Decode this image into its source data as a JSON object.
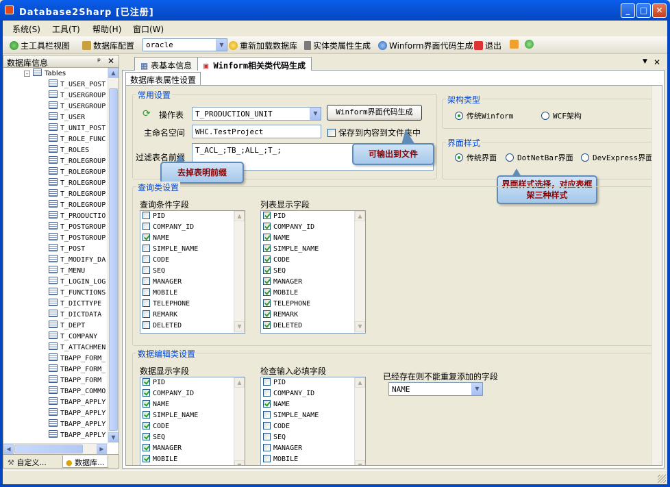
{
  "window": {
    "title": "Database2Sharp [已注册]"
  },
  "menu": [
    "系统(S)",
    "工具(T)",
    "帮助(H)",
    "窗口(W)"
  ],
  "toolbar": {
    "main_view": "主工具栏视图",
    "db_config": "数据库配置",
    "db_type": "oracle",
    "reload_db": "重新加载数据库",
    "entity_gen": "实体类属性生成",
    "winform_gen": "Winform界面代码生成",
    "exit": "退出"
  },
  "left_panel": {
    "title": "数据库信息",
    "root": "Tables",
    "tables": [
      "T_USER_POST",
      "T_USERGROUP",
      "T_USERGROUP",
      "T_USER",
      "T_UNIT_POST",
      "T_ROLE_FUNC",
      "T_ROLES",
      "T_ROLEGROUP",
      "T_ROLEGROUP",
      "T_ROLEGROUP",
      "T_ROLEGROUP",
      "T_ROLEGROUP",
      "T_PRODUCTIO",
      "T_POSTGROUP",
      "T_POSTGROUP",
      "T_POST",
      "T_MODIFY_DA",
      "T_MENU",
      "T_LOGIN_LOG",
      "T_FUNCTIONS",
      "T_DICTTYPE",
      "T_DICTDATA",
      "T_DEPT",
      "T_COMPANY",
      "T_ATTACHMEN",
      "TBAPP_FORM_",
      "TBAPP_FORM_",
      "TBAPP_FORM",
      "TBAPP_COMMO",
      "TBAPP_APPLY",
      "TBAPP_APPLY",
      "TBAPP_APPLY",
      "TBAPP_APPLY"
    ],
    "tab_custom": "自定义...",
    "tab_db": "数据库..."
  },
  "doc_tabs": {
    "tab1": "表基本信息",
    "tab2": "Winform相关类代码生成"
  },
  "sub_tab": "数据库表属性设置",
  "common": {
    "title": "常用设置",
    "table_label": "操作表",
    "table_value": "T_PRODUCTION_UNIT",
    "gen_button": "Winform界面代码生成",
    "ns_label": "主命名空间",
    "ns_value": "WHC.TestProject",
    "save_label": "保存到内容到文件夹中",
    "prefix_label": "过滤表名前缀",
    "prefix_value": "T_ACL_;TB_;ALL_;T_;"
  },
  "arch": {
    "title": "架构类型",
    "opt1": "传统Winform",
    "opt2": "WCF架构"
  },
  "ui_style": {
    "title": "界面样式",
    "opt1": "传统界面",
    "opt2": "DotNetBar界面",
    "opt3": "DevExpress界面"
  },
  "callouts": {
    "prefix": "去掉表明前缀",
    "output": "可输出到文件",
    "style": "界面样式选择，对应表框架三种样式"
  },
  "query": {
    "title": "查询类设置",
    "cond_label": "查询条件字段",
    "list_label": "列表显示字段",
    "cond_items": [
      {
        "name": "PID",
        "checked": false
      },
      {
        "name": "COMPANY_ID",
        "checked": false
      },
      {
        "name": "NAME",
        "checked": true
      },
      {
        "name": "SIMPLE_NAME",
        "checked": false
      },
      {
        "name": "CODE",
        "checked": false
      },
      {
        "name": "SEQ",
        "checked": false
      },
      {
        "name": "MANAGER",
        "checked": false
      },
      {
        "name": "MOBILE",
        "checked": false
      },
      {
        "name": "TELEPHONE",
        "checked": false
      },
      {
        "name": "REMARK",
        "checked": false
      },
      {
        "name": "DELETED",
        "checked": false
      }
    ],
    "list_items": [
      {
        "name": "PID",
        "checked": true
      },
      {
        "name": "COMPANY_ID",
        "checked": true
      },
      {
        "name": "NAME",
        "checked": true
      },
      {
        "name": "SIMPLE_NAME",
        "checked": true
      },
      {
        "name": "CODE",
        "checked": true
      },
      {
        "name": "SEQ",
        "checked": true
      },
      {
        "name": "MANAGER",
        "checked": true
      },
      {
        "name": "MOBILE",
        "checked": true
      },
      {
        "name": "TELEPHONE",
        "checked": true
      },
      {
        "name": "REMARK",
        "checked": true
      },
      {
        "name": "DELETED",
        "checked": true
      }
    ]
  },
  "edit": {
    "title": "数据编辑类设置",
    "display_label": "数据显示字段",
    "required_label": "检查输入必填字段",
    "unique_label": "已经存在则不能重复添加的字段",
    "unique_value": "NAME",
    "display_items": [
      {
        "name": "PID",
        "checked": true
      },
      {
        "name": "COMPANY_ID",
        "checked": true
      },
      {
        "name": "NAME",
        "checked": true
      },
      {
        "name": "SIMPLE_NAME",
        "checked": true
      },
      {
        "name": "CODE",
        "checked": true
      },
      {
        "name": "SEQ",
        "checked": true
      },
      {
        "name": "MANAGER",
        "checked": true
      },
      {
        "name": "MOBILE",
        "checked": true
      }
    ],
    "required_items": [
      {
        "name": "PID",
        "checked": false
      },
      {
        "name": "COMPANY_ID",
        "checked": false
      },
      {
        "name": "NAME",
        "checked": true
      },
      {
        "name": "SIMPLE_NAME",
        "checked": false
      },
      {
        "name": "CODE",
        "checked": false
      },
      {
        "name": "SEQ",
        "checked": false
      },
      {
        "name": "MANAGER",
        "checked": false
      },
      {
        "name": "MOBILE",
        "checked": false
      }
    ]
  }
}
